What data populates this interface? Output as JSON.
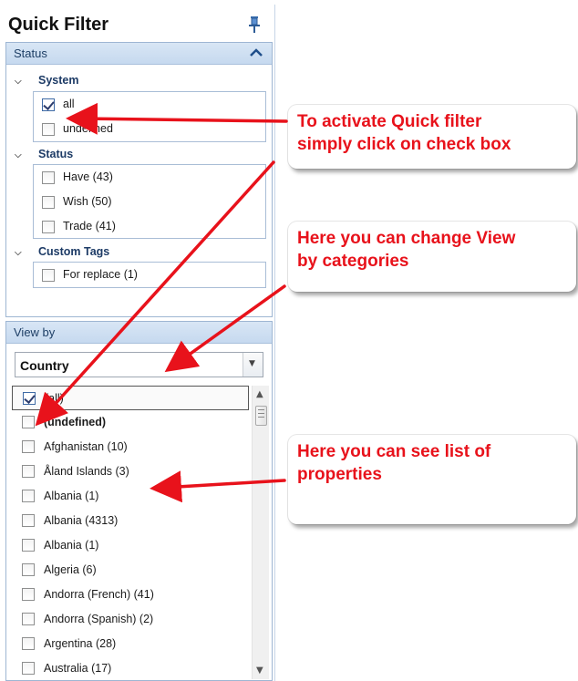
{
  "quick_filter": {
    "title": "Quick Filter",
    "status_section": {
      "header": "Status",
      "groups": [
        {
          "label": "System",
          "items": [
            {
              "label": "all",
              "checked": true
            },
            {
              "label": "undefined",
              "checked": false
            }
          ]
        },
        {
          "label": "Status",
          "items": [
            {
              "label": "Have (43)",
              "checked": false
            },
            {
              "label": "Wish (50)",
              "checked": false
            },
            {
              "label": "Trade (41)",
              "checked": false
            }
          ]
        },
        {
          "label": "Custom Tags",
          "items": [
            {
              "label": "For replace (1)",
              "checked": false
            }
          ]
        }
      ]
    },
    "view_by": {
      "header": "View by",
      "selected": "Country",
      "items": [
        {
          "label": "(all)",
          "checked": true
        },
        {
          "label": "(undefined)",
          "checked": false
        },
        {
          "label": "Afghanistan  (10)",
          "checked": false
        },
        {
          "label": "Åland Islands  (3)",
          "checked": false
        },
        {
          "label": "Albania  (1)",
          "checked": false
        },
        {
          "label": "Albania  (4313)",
          "checked": false
        },
        {
          "label": "Albania  (1)",
          "checked": false
        },
        {
          "label": "Algeria  (6)",
          "checked": false
        },
        {
          "label": "Andorra (French)  (41)",
          "checked": false
        },
        {
          "label": "Andorra (Spanish)  (2)",
          "checked": false
        },
        {
          "label": "Argentina  (28)",
          "checked": false
        },
        {
          "label": "Australia  (17)",
          "checked": false
        }
      ]
    }
  },
  "callouts": {
    "activate": [
      "To activate Quick filter",
      "simply click on check box"
    ],
    "categories": [
      "Here you can change View",
      "by categories"
    ],
    "properties": [
      "Here you can see list of",
      "properties"
    ]
  },
  "colors": {
    "annotation_red": "#e8121b",
    "header_blue": "#c6d9ef"
  }
}
